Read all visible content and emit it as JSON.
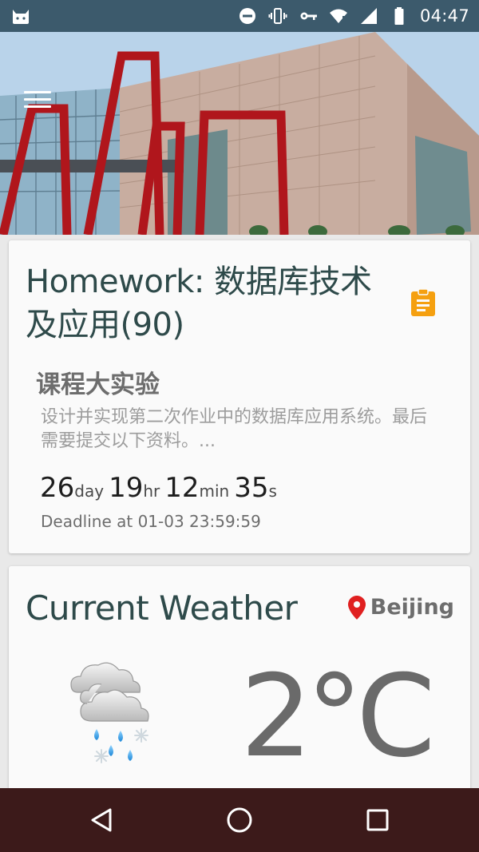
{
  "status_bar": {
    "time": "04:47",
    "icons": [
      "cat-app-icon",
      "do-not-disturb-icon",
      "vibrate-icon",
      "vpn-key-icon",
      "wifi-icon",
      "cell-signal-icon",
      "battery-icon"
    ]
  },
  "header": {
    "menu_icon": "hamburger-menu-icon"
  },
  "homework": {
    "title": "Homework: 数据库技术及应用(90)",
    "icon": "clipboard-icon",
    "icon_color": "#f5a010",
    "subtitle": "课程大实验",
    "description": "设计并实现第二次作业中的数据库应用系统。最后需要提交以下资料。...",
    "countdown": {
      "days": "26",
      "days_unit": "day",
      "hours": "19",
      "hours_unit": "hr",
      "minutes": "12",
      "minutes_unit": "min",
      "seconds": "35",
      "seconds_unit": "s"
    },
    "deadline": "Deadline at 01-03 23:59:59"
  },
  "weather": {
    "title": "Current Weather",
    "location": "Beijing",
    "location_icon": "location-pin-icon",
    "location_icon_color": "#e02020",
    "condition_icon": "rain-snow-cloud-icon",
    "temperature": "2°C"
  },
  "nav_bar": {
    "icons": [
      "back-icon",
      "home-icon",
      "recents-icon"
    ]
  },
  "colors": {
    "status_bar": "#3c5a6c",
    "nav_bar": "#3c1a1a",
    "title_text": "#2e4a4a"
  }
}
